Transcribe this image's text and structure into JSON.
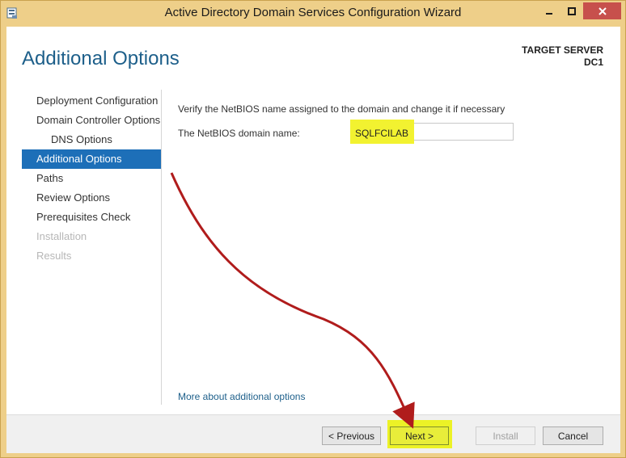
{
  "window": {
    "title": "Active Directory Domain Services Configuration Wizard",
    "app_icon": "server-manager-icon",
    "controls": {
      "minimize": "minimize-icon",
      "maximize": "maximize-icon",
      "close": "close-icon"
    }
  },
  "page": {
    "title": "Additional Options",
    "target_server_label": "TARGET SERVER",
    "target_server_name": "DC1"
  },
  "nav": {
    "items": [
      {
        "label": "Deployment Configuration",
        "state": "normal"
      },
      {
        "label": "Domain Controller Options",
        "state": "normal"
      },
      {
        "label": "DNS Options",
        "state": "normal"
      },
      {
        "label": "Additional Options",
        "state": "selected"
      },
      {
        "label": "Paths",
        "state": "normal"
      },
      {
        "label": "Review Options",
        "state": "normal"
      },
      {
        "label": "Prerequisites Check",
        "state": "normal"
      },
      {
        "label": "Installation",
        "state": "disabled"
      },
      {
        "label": "Results",
        "state": "disabled"
      }
    ]
  },
  "content": {
    "instruction": "Verify the NetBIOS name assigned to the domain and change it if necessary",
    "netbios_label": "The NetBIOS domain name:",
    "netbios_value": "SQLFCILAB",
    "more_link": "More about additional options"
  },
  "footer": {
    "previous": "< Previous",
    "next": "Next >",
    "install": "Install",
    "cancel": "Cancel"
  },
  "colors": {
    "title_accent": "#1d5f8a",
    "selected_nav": "#1d6fb8",
    "highlight": "#f2f230",
    "annotation_arrow": "#b01c1c"
  },
  "annotations": {
    "arrow": "red-curved-arrow-icon"
  }
}
